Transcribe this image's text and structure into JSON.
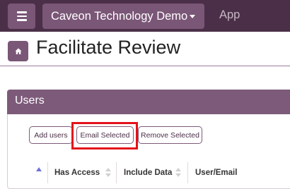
{
  "topbar": {
    "menu_icon": "hamburger-menu-icon",
    "demo_label": "Caveon Technology Demo",
    "app_label": "App"
  },
  "page": {
    "home_icon": "home-icon",
    "title": "Facilitate Review"
  },
  "panel": {
    "title": "Users",
    "buttons": {
      "add": "Add users",
      "email": "Email Selected",
      "remove": "Remove Selected"
    },
    "columns": [
      "Has Access",
      "Include Data",
      "User/Email"
    ]
  },
  "colors": {
    "topbar": "#4b2f48",
    "accent": "#7a5677",
    "highlight": "#e4121b"
  }
}
